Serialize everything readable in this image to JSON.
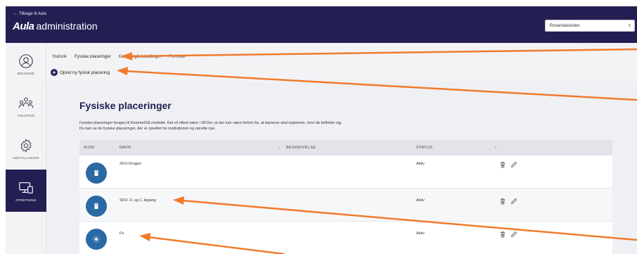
{
  "header": {
    "back_label": "Tilbage til Aula",
    "logo": "Aula",
    "app_title": "administration",
    "school_selected": "Rosendalskolen"
  },
  "sidebar": {
    "items": [
      {
        "label": "BRUGERE",
        "icon": "user-icon"
      },
      {
        "label": "GRUPPER",
        "icon": "group-icon"
      },
      {
        "label": "INDSTILLINGER",
        "icon": "gear-icon"
      },
      {
        "label": "OPRETNING",
        "icon": "devices-icon"
      }
    ]
  },
  "subnav": {
    "tabs": [
      "Statistik",
      "Fysiske placeringer",
      "Komme/gå indstillinger",
      "Formuler"
    ],
    "create_label": "Opret ny fysisk placering"
  },
  "main": {
    "title": "Fysiske placeringer",
    "description_line1": "Fysiske placeringer bruges til Komme/Gå modulet. Det vil oftest være i SFOer, at der kan være behov for, at børnene skal registrere, hvor de befinder sig.",
    "description_line2": "Du kan se de fysiske placeringer, der er oprettet for institutionen og oprette nye.",
    "columns": {
      "icon": "IKON",
      "name": "NAVN",
      "sort": "↓",
      "description": "BESKRIVELSE",
      "status": "STATUS",
      "extra": "⁝"
    },
    "rows": [
      {
        "name": "SFO-Dragen",
        "description": "",
        "status": "Aktiv",
        "icon": "building-icon"
      },
      {
        "name": "SFO- 0. og 1. årgang",
        "description": "",
        "status": "Aktiv",
        "icon": "building-icon"
      },
      {
        "name": "Fri",
        "description": "",
        "status": "Aktiv",
        "icon": "sun-icon"
      }
    ]
  },
  "colors": {
    "brand": "#231f53",
    "icon_circle": "#2b69a5",
    "annotation": "#f07b2c"
  }
}
